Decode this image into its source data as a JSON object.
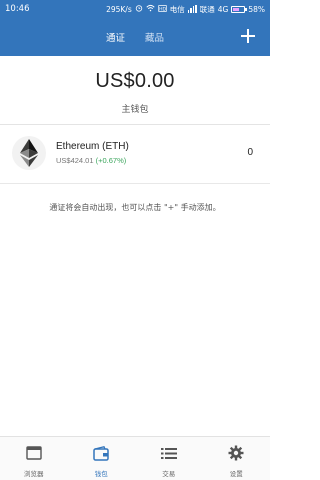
{
  "status_bar": {
    "time": "10:46",
    "network_speed": "295K/s",
    "carrier1": "电信",
    "carrier2": "联通",
    "network_type": "4G",
    "battery": "58%",
    "battery_level": 0.58
  },
  "header": {
    "tabs": [
      {
        "label": "通证",
        "active": true
      },
      {
        "label": "藏品",
        "active": false
      }
    ],
    "add_icon": "plus-icon"
  },
  "wallet": {
    "balance": "US$0.00",
    "name": "主钱包"
  },
  "tokens": [
    {
      "name": "Ethereum (ETH)",
      "price": "US$424.01",
      "change": "(+0.67%)",
      "balance": "0",
      "icon": "ethereum-icon"
    }
  ],
  "hint": "通证将会自动出现，也可以点击 \"+\" 手动添加。",
  "bottom_nav": [
    {
      "label": "浏览器",
      "icon": "browser-icon",
      "active": false
    },
    {
      "label": "钱包",
      "icon": "wallet-icon",
      "active": true
    },
    {
      "label": "交易",
      "icon": "list-icon",
      "active": false
    },
    {
      "label": "设置",
      "icon": "gear-icon",
      "active": false
    }
  ],
  "colors": {
    "primary": "#3375bb",
    "positive": "#3ba55c"
  }
}
